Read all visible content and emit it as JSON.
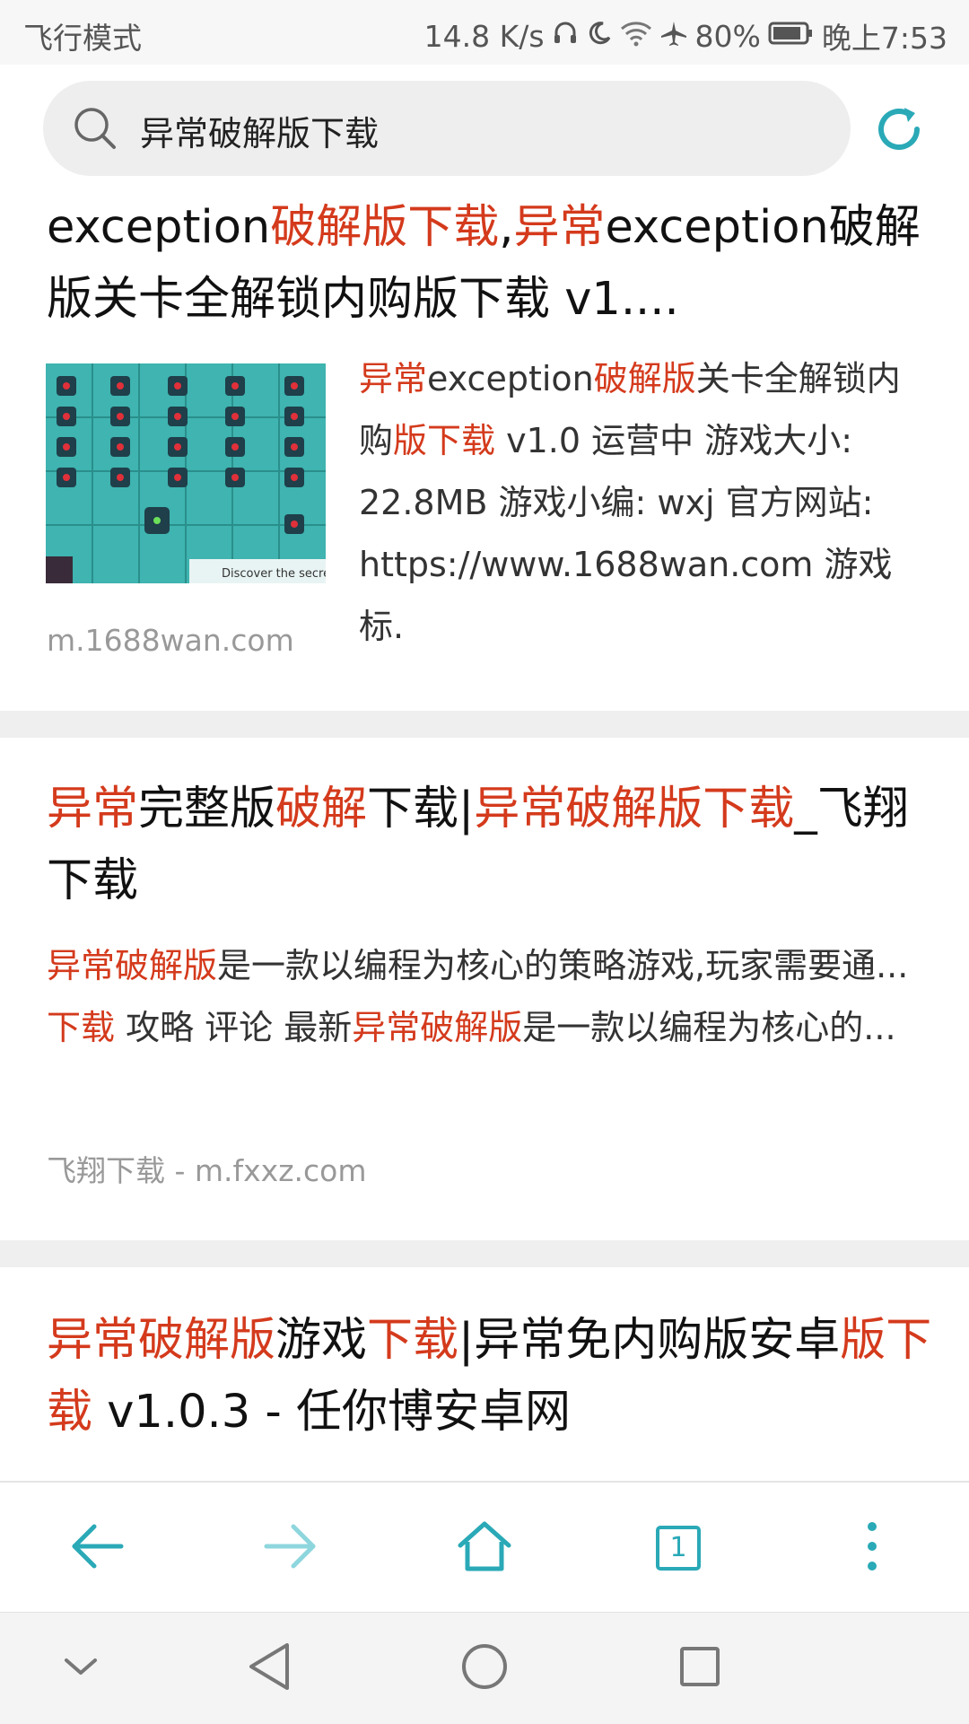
{
  "status_bar": {
    "mode": "飞行模式",
    "speed": "14.8 K/s",
    "battery": "80%",
    "time": "晚上7:53",
    "icons": [
      "headphones-icon",
      "moon-icon",
      "wifi-icon",
      "airplane-icon",
      "battery-icon"
    ]
  },
  "search": {
    "query": "异常破解版下载"
  },
  "results": [
    {
      "title_parts": [
        {
          "text": "exception",
          "hl": false
        },
        {
          "text": "破解版下载",
          "hl": true
        },
        {
          "text": ",",
          "hl": false
        },
        {
          "text": "异常",
          "hl": true
        },
        {
          "text": "exception破解版关卡全解锁内购版下载 v1....",
          "hl": false
        }
      ],
      "desc_parts": [
        {
          "text": "异常",
          "hl": true
        },
        {
          "text": "exception",
          "hl": false
        },
        {
          "text": "破解版",
          "hl": true
        },
        {
          "text": "关卡全解锁内购",
          "hl": false
        },
        {
          "text": "版下载",
          "hl": true
        },
        {
          "text": " v1.0 运营中 游戏大小: 22.8MB 游戏小编: wxj 官方网站: https://www.1688wan.com 游戏标.",
          "hl": false
        }
      ],
      "thumb_caption": "Discover the secre",
      "source": "m.1688wan.com"
    },
    {
      "title_parts": [
        {
          "text": "异常",
          "hl": true
        },
        {
          "text": "完整版",
          "hl": false
        },
        {
          "text": "破解",
          "hl": true
        },
        {
          "text": "下载|",
          "hl": false
        },
        {
          "text": "异常破解版下载",
          "hl": true
        },
        {
          "text": "_飞翔下载",
          "hl": false
        }
      ],
      "desc_parts": [
        {
          "text": "异常破解版",
          "hl": true
        },
        {
          "text": "是一款以编程为核心的策略游戏,玩家需要通... ",
          "hl": false
        },
        {
          "text": "下载",
          "hl": true
        },
        {
          "text": " 攻略 评论 最新",
          "hl": false
        },
        {
          "text": "异常破解版",
          "hl": true
        },
        {
          "text": "是一款以编程为核心的...",
          "hl": false
        }
      ],
      "source": "飞翔下载 - m.fxxz.com"
    },
    {
      "title_parts": [
        {
          "text": "异常破解版",
          "hl": true
        },
        {
          "text": "游戏",
          "hl": false
        },
        {
          "text": "下载",
          "hl": true
        },
        {
          "text": "|异常免内购版安卓",
          "hl": false
        },
        {
          "text": "版下载",
          "hl": true
        },
        {
          "text": " v1.0.3 - 任你博安卓网",
          "hl": false
        }
      ]
    }
  ],
  "toolbar": {
    "tab_count": "1",
    "icons": [
      "back-arrow-icon",
      "forward-arrow-icon",
      "home-icon",
      "tabs-icon",
      "more-vertical-icon"
    ]
  },
  "nav": {
    "icons": [
      "hide-keyboard-icon",
      "back-triangle-icon",
      "home-circle-icon",
      "recents-square-icon"
    ]
  },
  "colors": {
    "accent": "#2aa9b7",
    "highlight": "#d43a1c",
    "source": "#999999"
  }
}
